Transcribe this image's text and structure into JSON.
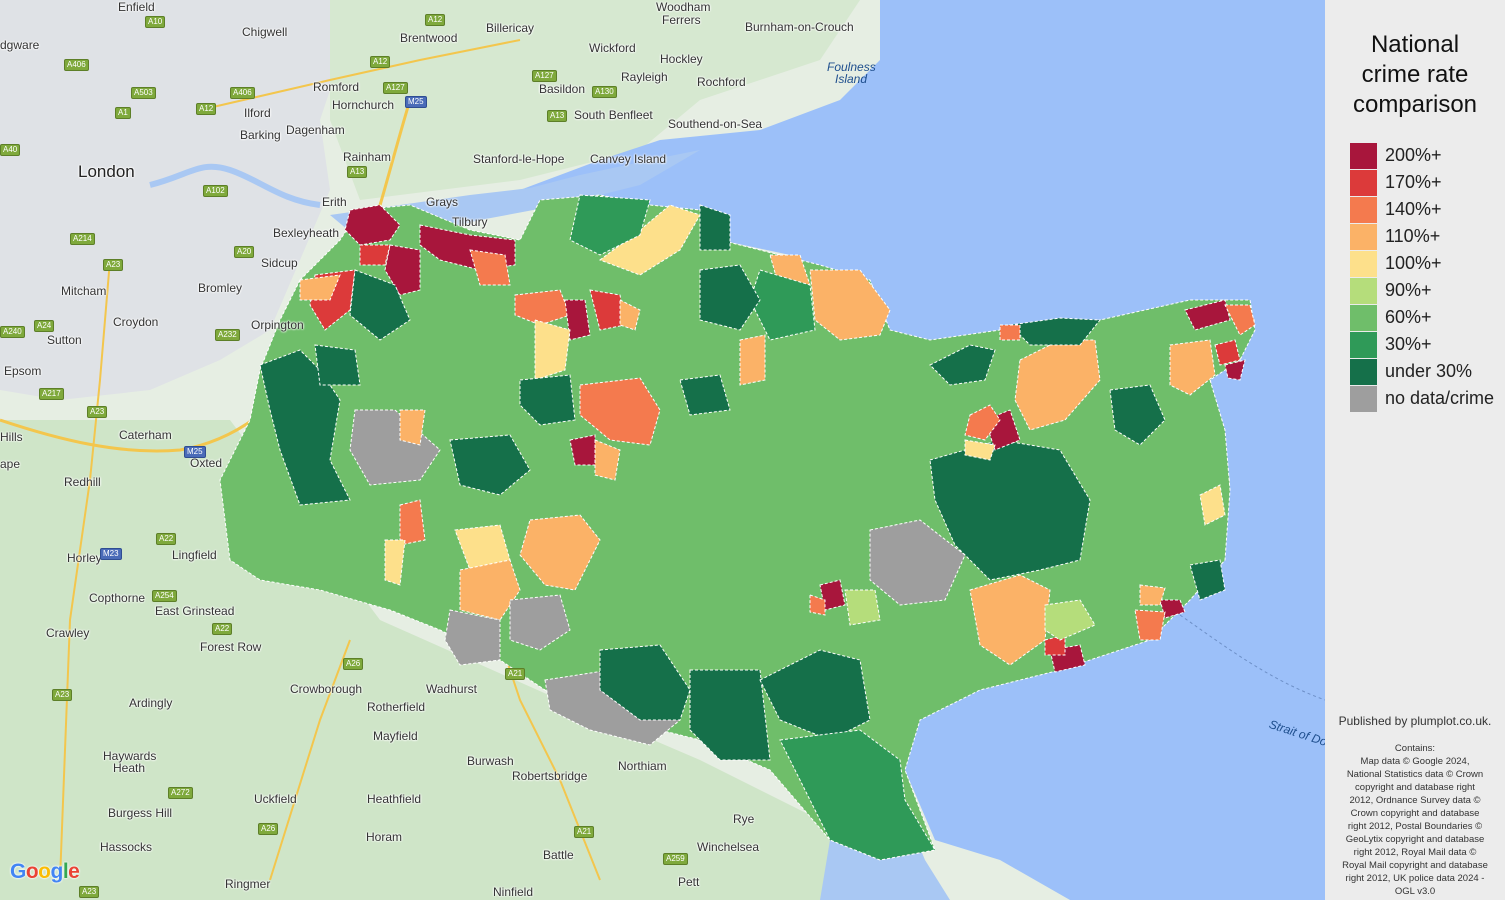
{
  "legend": {
    "title_lines": [
      "National",
      "crime rate",
      "comparison"
    ],
    "items": [
      {
        "label": "200%+",
        "color": "#a8163c"
      },
      {
        "label": "170%+",
        "color": "#dc3a3a"
      },
      {
        "label": "140%+",
        "color": "#f47a4e"
      },
      {
        "label": "110%+",
        "color": "#fbb267"
      },
      {
        "label": "100%+",
        "color": "#fde08b"
      },
      {
        "label": "90%+",
        "color": "#b5dd7b"
      },
      {
        "label": "60%+",
        "color": "#6fbe6a"
      },
      {
        "label": "30%+",
        "color": "#2f9a58"
      },
      {
        "label": "under 30%",
        "color": "#15704a"
      },
      {
        "label": "no data/crime",
        "color": "#9e9e9e"
      }
    ]
  },
  "credits": {
    "published": "Published by plumplot.co.uk.",
    "contains_lines": [
      "Contains:",
      "Map data © Google 2024,",
      "National Statistics data © Crown",
      "copyright and database right",
      "2012, Ordnance Survey data ©",
      "Crown copyright and database",
      "right 2012, Postal Boundaries ©",
      "GeoLytix copyright and database",
      "right 2012, Royal Mail data ©",
      "Royal Mail copyright and database",
      "right 2012, UK police data 2024 -",
      "OGL v3.0"
    ]
  },
  "map": {
    "logo": "Google",
    "colors": {
      "sea": "#9cc0f9",
      "land": "#e6eee3",
      "estuary": "#a9c8f3"
    },
    "places": [
      {
        "name": "Enfield"
      },
      {
        "name": "Woodham"
      },
      {
        "name": "Ferrers"
      },
      {
        "name": "dgware"
      },
      {
        "name": "Chigwell"
      },
      {
        "name": "Brentwood"
      },
      {
        "name": "Billericay"
      },
      {
        "name": "Wickford"
      },
      {
        "name": "Burnham-on-Crouch"
      },
      {
        "name": "Hockley"
      },
      {
        "name": "Foulness"
      },
      {
        "name": "Island"
      },
      {
        "name": "Romford"
      },
      {
        "name": "Rayleigh"
      },
      {
        "name": "Rochford"
      },
      {
        "name": "Ilford"
      },
      {
        "name": "Hornchurch"
      },
      {
        "name": "Basildon"
      },
      {
        "name": "Barking"
      },
      {
        "name": "Dagenham"
      },
      {
        "name": "South Benfleet"
      },
      {
        "name": "Southend-on-Sea"
      },
      {
        "name": "London"
      },
      {
        "name": "Rainham"
      },
      {
        "name": "Stanford-le-Hope"
      },
      {
        "name": "Canvey Island"
      },
      {
        "name": "Erith"
      },
      {
        "name": "Grays"
      },
      {
        "name": "Tilbury"
      },
      {
        "name": "Bexleyheath"
      },
      {
        "name": "Sidcup"
      },
      {
        "name": "Bromley"
      },
      {
        "name": "Mitcham"
      },
      {
        "name": "Croydon"
      },
      {
        "name": "Orpington"
      },
      {
        "name": "Sutton"
      },
      {
        "name": "Epsom"
      },
      {
        "name": "Caterham"
      },
      {
        "name": "Oxted"
      },
      {
        "name": "Redhill"
      },
      {
        "name": "Horley"
      },
      {
        "name": "Lingfield"
      },
      {
        "name": "Copthorne"
      },
      {
        "name": "East Grinstead"
      },
      {
        "name": "Crawley"
      },
      {
        "name": "Forest Row"
      },
      {
        "name": "Crowborough"
      },
      {
        "name": "Wadhurst"
      },
      {
        "name": "Ardingly"
      },
      {
        "name": "Rotherfield"
      },
      {
        "name": "Mayfield"
      },
      {
        "name": "Haywards"
      },
      {
        "name": "Heath"
      },
      {
        "name": "Burwash"
      },
      {
        "name": "Robertsbridge"
      },
      {
        "name": "Northiam"
      },
      {
        "name": "Heathfield"
      },
      {
        "name": "Uckfield"
      },
      {
        "name": "Burgess Hill"
      },
      {
        "name": "Hassocks"
      },
      {
        "name": "Horam"
      },
      {
        "name": "Rye"
      },
      {
        "name": "Winchelsea"
      },
      {
        "name": "Battle"
      },
      {
        "name": "Ringmer"
      },
      {
        "name": "Ninfield"
      },
      {
        "name": "Pett"
      },
      {
        "name": "Hills"
      },
      {
        "name": "ape"
      },
      {
        "name": "Strait of Do"
      }
    ],
    "roads": [
      {
        "ref": "A10"
      },
      {
        "ref": "A12"
      },
      {
        "ref": "A406"
      },
      {
        "ref": "A12"
      },
      {
        "ref": "A127"
      },
      {
        "ref": "A503"
      },
      {
        "ref": "A406"
      },
      {
        "ref": "M25"
      },
      {
        "ref": "A127"
      },
      {
        "ref": "A130"
      },
      {
        "ref": "A12"
      },
      {
        "ref": "A1"
      },
      {
        "ref": "A13"
      },
      {
        "ref": "A40"
      },
      {
        "ref": "A13"
      },
      {
        "ref": "A102"
      },
      {
        "ref": "A214"
      },
      {
        "ref": "A20"
      },
      {
        "ref": "A23"
      },
      {
        "ref": "A232"
      },
      {
        "ref": "A240"
      },
      {
        "ref": "A24"
      },
      {
        "ref": "A217"
      },
      {
        "ref": "A23"
      },
      {
        "ref": "M25"
      },
      {
        "ref": "A22"
      },
      {
        "ref": "M23"
      },
      {
        "ref": "A254"
      },
      {
        "ref": "A22"
      },
      {
        "ref": "A26"
      },
      {
        "ref": "A23"
      },
      {
        "ref": "A21"
      },
      {
        "ref": "A26"
      },
      {
        "ref": "A272"
      },
      {
        "ref": "A21"
      },
      {
        "ref": "A259"
      },
      {
        "ref": "A23"
      }
    ]
  }
}
